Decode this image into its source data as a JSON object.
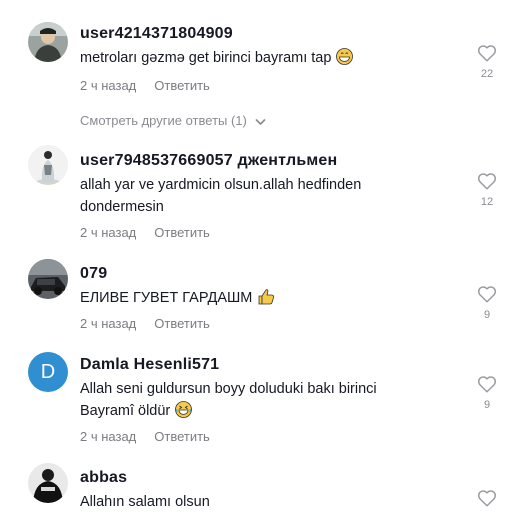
{
  "comments": [
    {
      "username": "user4214371804909",
      "text": "metroları gəzmə get birinci bayramı tap",
      "emoji": "grin-emoji",
      "time": "2 ч назад",
      "reply": "Ответить",
      "likes": "22"
    },
    {
      "username": "user7948537669057 джентльмен",
      "text": "allah yar ve yardmicin olsun.allah hedfinden dondermesin",
      "time": "2 ч назад",
      "reply": "Ответить",
      "likes": "12"
    },
    {
      "username": "079",
      "text": "ЕЛИВЕ ГУВЕТ ГАРДАШМ",
      "emoji": "thumbs-up-emoji",
      "time": "2 ч назад",
      "reply": "Ответить",
      "likes": "9"
    },
    {
      "username": "Damla Hesenli571",
      "avatar_letter": "D",
      "text": "Allah seni guldursun boyy doluduki bakı birinci Bayramî öldür",
      "emoji": "laugh-emoji",
      "time": "2 ч назад",
      "reply": "Ответить",
      "likes": "9"
    },
    {
      "username": "abbas",
      "text": "Allahın salamı olsun"
    }
  ],
  "view_more_replies": "Смотреть другие ответы (1)",
  "colors": {
    "meta": "#7b7c82",
    "avatar_letter_bg": "#2f8fd0",
    "emoji": "#f7c948"
  }
}
